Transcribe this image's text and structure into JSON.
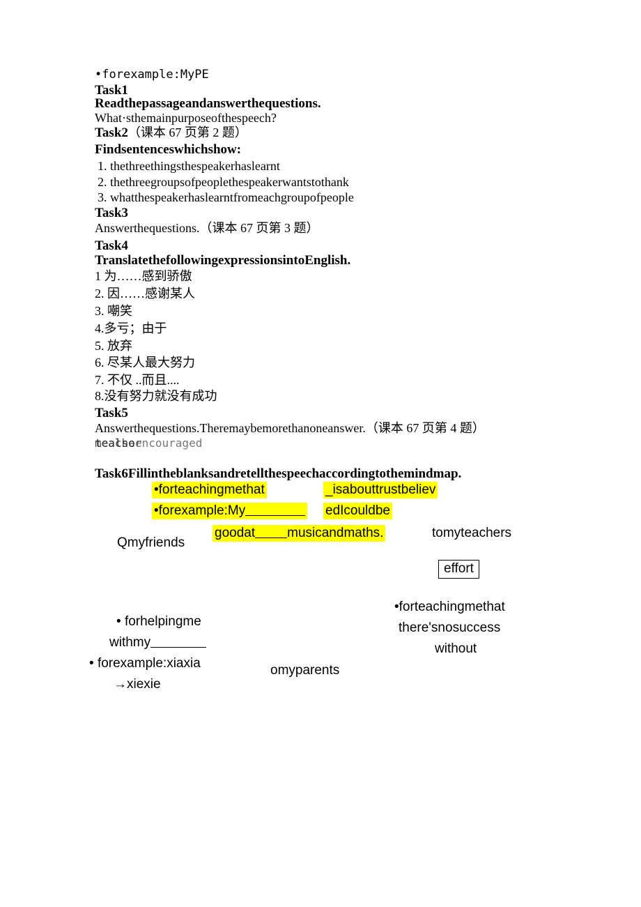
{
  "document": {
    "kind": "english-worksheet-scan",
    "highlight_color": "#ffff00",
    "text_color": "#000000",
    "background": "#ffffff"
  },
  "top_line": {
    "bullet": "•",
    "text": "forexample:MyPE"
  },
  "tasks": [
    {
      "id": "task1",
      "heading": "Task1",
      "instruction": "Readthepassageandanswerthequestions.",
      "question": "What·sthemainpurposeofthespeech?"
    },
    {
      "id": "task2",
      "heading": "Task2",
      "source_note": "（课本 67 页第 2 题）",
      "instruction": "Findsentenceswhichshow:",
      "items": [
        "1. thethreethingsthespeakerhaslearnt",
        "2. thethreegroupsofpeoplethespeakerwantstothank",
        "3. whatthespeakerhaslearntfromeachgroupofpeople"
      ]
    },
    {
      "id": "task3",
      "heading": "Task3",
      "instruction": "Answerthequestions.",
      "source_note": "（课本 67 页第 3 题）"
    },
    {
      "id": "task4",
      "heading": "Task4",
      "instruction": "TranslatethefollowingexpressionsintoEnglish.",
      "items": [
        "1 为……感到骄傲",
        "2. 因……感谢某人",
        "3. 嘲笑",
        "4.多亏；由于",
        "5. 放弃",
        "6. 尽某人最大努力",
        "7. 不仅 ..而且....",
        "8.没有努力就没有成功"
      ]
    },
    {
      "id": "task5",
      "heading": "Task5",
      "instruction": "Answerthequestions.Theremaybemorethanoneanswer.",
      "source_note": "（课本 67 页第 4 题）"
    },
    {
      "id": "task6",
      "heading": "Task6Fillintheblanksandretellthespeechaccordingtothemindmap."
    }
  ],
  "overlap_artifact": {
    "layer_a": "meacher",
    "layer_b": "tealso",
    "layer_c": "encouraged"
  },
  "mindmap": {
    "highlight_blocks": [
      {
        "id": "block-left",
        "lines": [
          "•forteachingmethat",
          "•forexample:My"
        ],
        "has_blank": true
      },
      {
        "id": "block-right",
        "lines": [
          "_isabouttrustbeliev",
          "edIcouldbe"
        ]
      },
      {
        "id": "block-goodat",
        "text_before": "goodat",
        "text_after": "musicandmaths."
      }
    ],
    "labels": {
      "my_friends": "Qmyfriends",
      "to_my_teachers": "tomyteachers",
      "effort_box": "effort",
      "my_parents": "omyparents"
    },
    "left_branch": {
      "line1_bullet": "•",
      "line1": "forhelpingme",
      "line2": "withmy",
      "line3_bullet": "•",
      "line3": "forexample:xiaxia",
      "line4_arrow": "→",
      "line4": "xiexie"
    },
    "right_branch": {
      "line1": "•forteachingmethat",
      "line2": "there'snosuccess",
      "line3": "without"
    }
  }
}
